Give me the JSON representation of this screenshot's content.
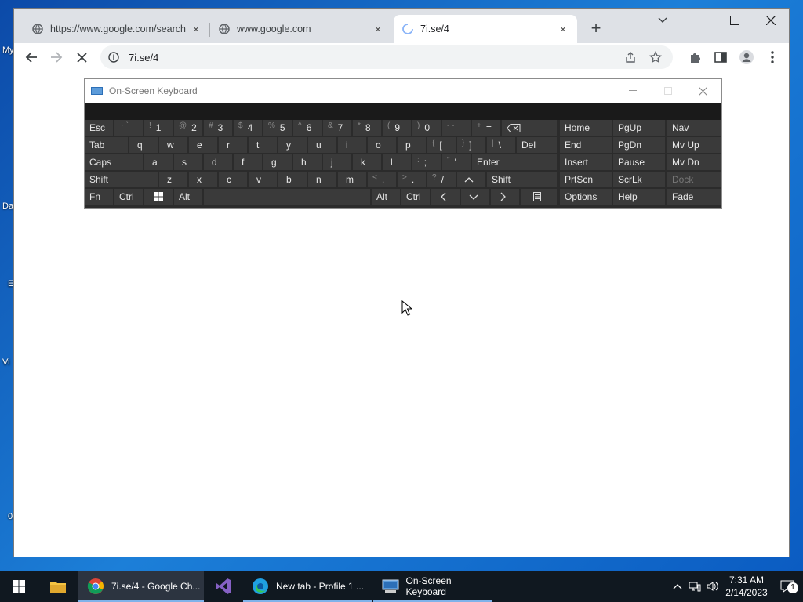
{
  "desktop": {
    "labels": [
      "My",
      "Da",
      "E",
      "Vi",
      "0"
    ]
  },
  "chrome": {
    "tabs": [
      {
        "title": "https://www.google.com/search",
        "close": "×"
      },
      {
        "title": "www.google.com",
        "close": "×"
      },
      {
        "title": "7i.se/4",
        "close": "×"
      }
    ],
    "new_tab": "+",
    "address": "7i.se/4"
  },
  "osk": {
    "title": "On-Screen Keyboard",
    "keys": {
      "esc": "Esc",
      "backtick_shift": "~ `",
      "n1_shift": "!",
      "n1": "1",
      "n2_shift": "@",
      "n2": "2",
      "n3_shift": "#",
      "n3": "3",
      "n4_shift": "$",
      "n4": "4",
      "n5_shift": "%",
      "n5": "5",
      "n6_shift": "^",
      "n6": "6",
      "n7_shift": "&",
      "n7": "7",
      "n8_shift": "*",
      "n8": "8",
      "n9_shift": "(",
      "n9": "9",
      "n0_shift": ")",
      "n0": "0",
      "minus": "- -",
      "equals_shift": "+",
      "equals": "=",
      "tab": "Tab",
      "q": "q",
      "w": "w",
      "e": "e",
      "r": "r",
      "t": "t",
      "y": "y",
      "u": "u",
      "i": "i",
      "o": "o",
      "p": "p",
      "lbracket_shift": "{",
      "lbracket": "[",
      "rbracket_shift": "}",
      "rbracket": "]",
      "backslash_shift": "|",
      "backslash": "\\",
      "del": "Del",
      "caps": "Caps",
      "a": "a",
      "s": "s",
      "d": "d",
      "f": "f",
      "g": "g",
      "h": "h",
      "j": "j",
      "k": "k",
      "l": "l",
      "semicolon_shift": ":",
      "semicolon": ";",
      "quote_shift": "\"",
      "quote": "'",
      "enter": "Enter",
      "shift_l": "Shift",
      "z": "z",
      "x": "x",
      "c": "c",
      "v": "v",
      "b": "b",
      "n": "n",
      "m": "m",
      "comma_shift": "<",
      "comma": ",",
      "period_shift": ">",
      "period": ".",
      "slash_shift": "?",
      "slash": "/",
      "shift_r": "Shift",
      "fn": "Fn",
      "ctrl_l": "Ctrl",
      "alt_l": "Alt",
      "alt_r": "Alt",
      "ctrl_r": "Ctrl",
      "home": "Home",
      "pgup": "PgUp",
      "nav": "Nav",
      "end": "End",
      "pgdn": "PgDn",
      "mvup": "Mv Up",
      "insert": "Insert",
      "pause": "Pause",
      "mvdn": "Mv Dn",
      "prtscn": "PrtScn",
      "scrlk": "ScrLk",
      "dock": "Dock",
      "options": "Options",
      "help": "Help",
      "fade": "Fade"
    }
  },
  "taskbar": {
    "items": [
      {
        "label": "7i.se/4 - Google Ch..."
      },
      {
        "label": "New tab - Profile 1 ..."
      },
      {
        "label": "On-Screen Keyboard"
      }
    ],
    "time": "7:31 AM",
    "date": "2/14/2023",
    "notifications": "1"
  }
}
